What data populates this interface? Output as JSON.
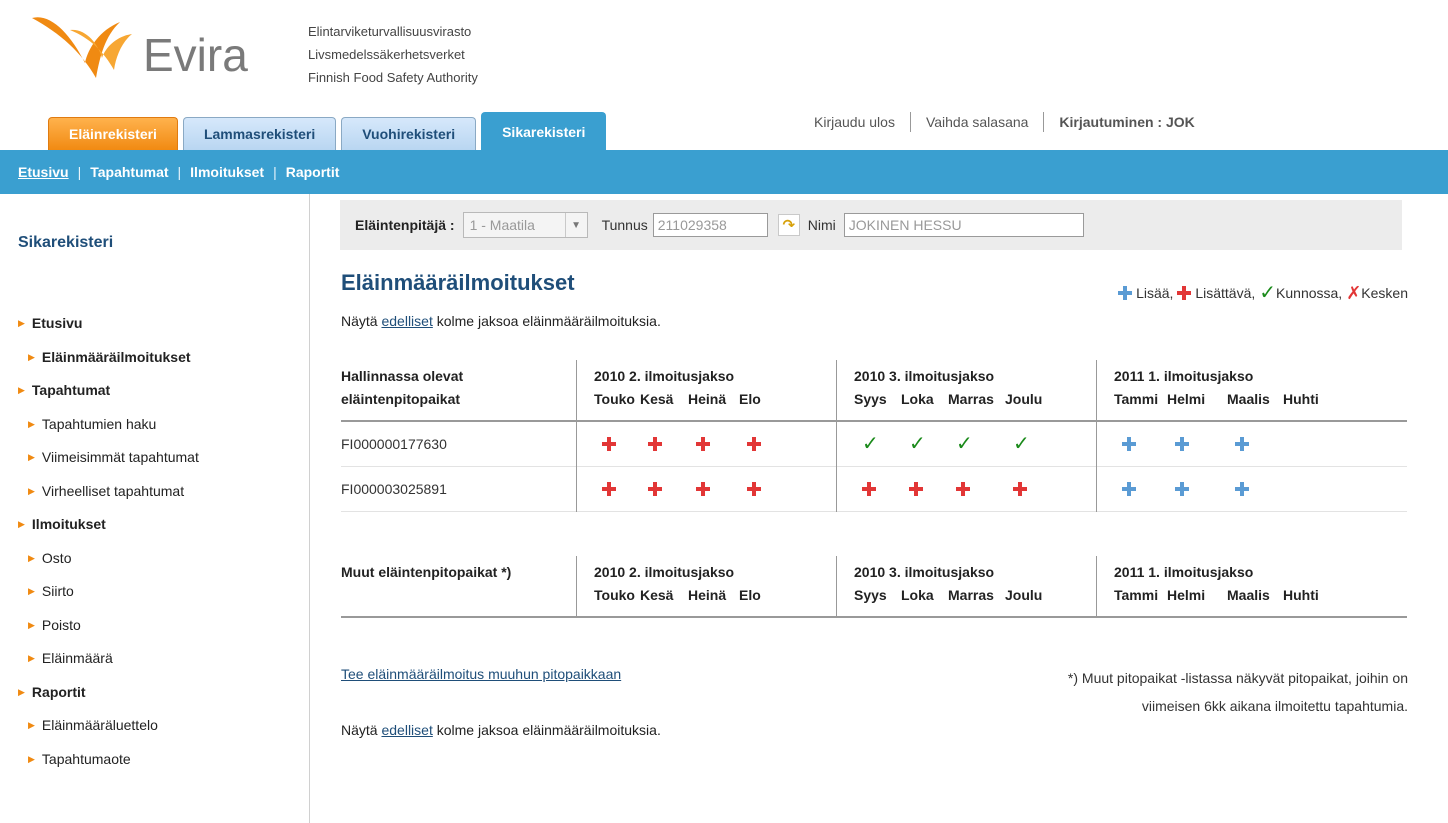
{
  "logo": {
    "text": "Evira"
  },
  "agency": {
    "line1": "Elintarviketurvallisuusvirasto",
    "line2": "Livsmedelssäkerhetsverket",
    "line3": "Finnish Food Safety Authority"
  },
  "tabs": [
    {
      "label": "Eläinrekisteri"
    },
    {
      "label": "Lammasrekisteri"
    },
    {
      "label": "Vuohirekisteri"
    },
    {
      "label": "Sikarekisteri"
    }
  ],
  "user": {
    "logout": "Kirjaudu ulos",
    "change_password": "Vaihda salasana",
    "login_info": "Kirjautuminen : JOK"
  },
  "nav": [
    {
      "label": "Etusivu"
    },
    {
      "label": "Tapahtumat"
    },
    {
      "label": "Ilmoitukset"
    },
    {
      "label": "Raportit"
    }
  ],
  "sidebar": {
    "title": "Sikarekisteri",
    "items": [
      {
        "label": "Etusivu"
      },
      {
        "label": "Eläinmääräilmoitukset"
      },
      {
        "label": "Tapahtumat"
      },
      {
        "label": "Tapahtumien haku"
      },
      {
        "label": "Viimeisimmät tapahtumat"
      },
      {
        "label": "Virheelliset tapahtumat"
      },
      {
        "label": "Ilmoitukset"
      },
      {
        "label": "Osto"
      },
      {
        "label": "Siirto"
      },
      {
        "label": "Poisto"
      },
      {
        "label": "Eläinmäärä"
      },
      {
        "label": "Raportit"
      },
      {
        "label": "Eläinmääräluettelo"
      },
      {
        "label": "Tapahtumaote"
      }
    ]
  },
  "holder": {
    "label": "Eläintenpitäjä :",
    "select_value": "1 - Maatila",
    "id_label": "Tunnus",
    "id_value": "211029358",
    "name_label": "Nimi",
    "name_value": "JOKINEN HESSU"
  },
  "main": {
    "title": "Eläinmääräilmoitukset",
    "show_prefix": "Näytä",
    "show_link": "edelliset",
    "show_suffix": "kolme jaksoa eläinmääräilmoituksia."
  },
  "legend": {
    "add": "Lisää,",
    "addable": "Lisättävä,",
    "ok": "Kunnossa,",
    "pending": "Kesken"
  },
  "table1": {
    "col0_line1": "Hallinnassa olevat",
    "col0_line2": "eläintenpitopaikat",
    "periods": [
      {
        "title": "2010 2. ilmoitusjakso",
        "months": [
          "Touko",
          "Kesä",
          "Heinä",
          "Elo"
        ]
      },
      {
        "title": "2010 3. ilmoitusjakso",
        "months": [
          "Syys",
          "Loka",
          "Marras",
          "Joulu"
        ]
      },
      {
        "title": "2011 1. ilmoitusjakso",
        "months": [
          "Tammi",
          "Helmi",
          "Maalis",
          "Huhti"
        ]
      }
    ],
    "rows": [
      {
        "id": "FI000000177630",
        "status": [
          "addable",
          "addable",
          "addable",
          "addable",
          "ok",
          "ok",
          "ok",
          "ok",
          "add",
          "add",
          "add",
          ""
        ]
      },
      {
        "id": "FI000003025891",
        "status": [
          "addable",
          "addable",
          "addable",
          "addable",
          "addable",
          "addable",
          "addable",
          "addable",
          "add",
          "add",
          "add",
          ""
        ]
      }
    ]
  },
  "table2": {
    "col0": "Muut eläintenpitopaikat *)",
    "periods": [
      {
        "title": "2010 2. ilmoitusjakso",
        "months": [
          "Touko",
          "Kesä",
          "Heinä",
          "Elo"
        ]
      },
      {
        "title": "2010 3. ilmoitusjakso",
        "months": [
          "Syys",
          "Loka",
          "Marras",
          "Joulu"
        ]
      },
      {
        "title": "2011 1. ilmoitusjakso",
        "months": [
          "Tammi",
          "Helmi",
          "Maalis",
          "Huhti"
        ]
      }
    ]
  },
  "other_link": "Tee eläinmääräilmoitus muuhun pitopaikkaan",
  "footnote": {
    "line1": "*) Muut pitopaikat -listassa näkyvät pitopaikat, joihin on",
    "line2": "viimeisen 6kk aikana ilmoitettu tapahtumia."
  }
}
